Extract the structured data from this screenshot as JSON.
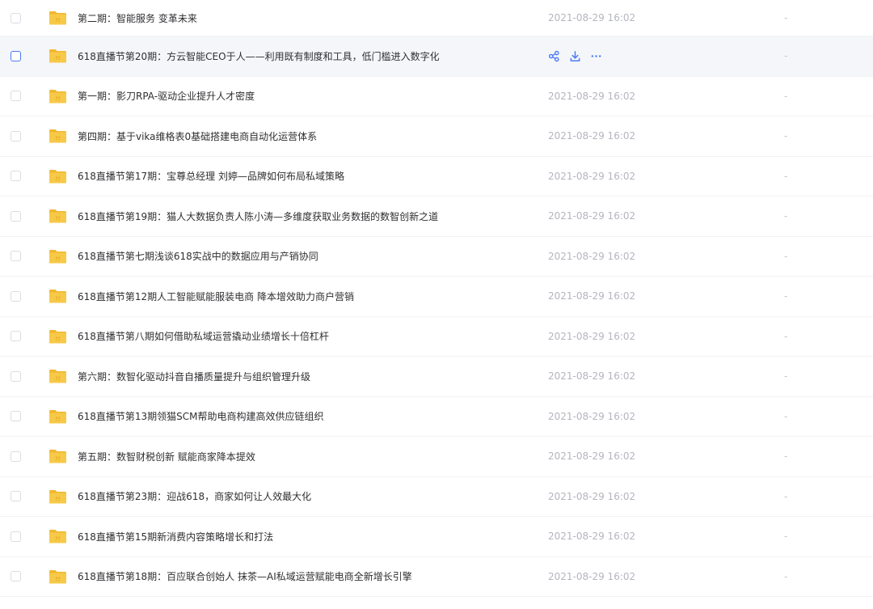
{
  "files": [
    {
      "name": "第二期：智能服务 变革未来",
      "modified": "2021-08-29 16:02",
      "size": "-"
    },
    {
      "name": "618直播节第20期：方云智能CEO于人——利用既有制度和工具，低门槛进入数字化",
      "modified": "2021-08-29 16:02",
      "size": "-",
      "hovered": true
    },
    {
      "name": "第一期：影刀RPA-驱动企业提升人才密度",
      "modified": "2021-08-29 16:02",
      "size": "-"
    },
    {
      "name": "第四期：基于vika维格表0基础搭建电商自动化运营体系",
      "modified": "2021-08-29 16:02",
      "size": "-"
    },
    {
      "name": "618直播节第17期：宝尊总经理 刘婷—品牌如何布局私域策略",
      "modified": "2021-08-29 16:02",
      "size": "-"
    },
    {
      "name": "618直播节第19期：猫人大数据负责人陈小涛—多维度获取业务数据的数智创新之道",
      "modified": "2021-08-29 16:02",
      "size": "-"
    },
    {
      "name": "618直播节第七期浅谈618实战中的数据应用与产销协同",
      "modified": "2021-08-29 16:02",
      "size": "-"
    },
    {
      "name": "618直播节第12期人工智能赋能服装电商 降本增效助力商户营销",
      "modified": "2021-08-29 16:02",
      "size": "-"
    },
    {
      "name": "618直播节第八期如何借助私域运营撬动业绩增长十倍杠杆",
      "modified": "2021-08-29 16:02",
      "size": "-"
    },
    {
      "name": "第六期：数智化驱动抖音自播质量提升与组织管理升级",
      "modified": "2021-08-29 16:02",
      "size": "-"
    },
    {
      "name": "618直播节第13期领猫SCM帮助电商构建高效供应链组织",
      "modified": "2021-08-29 16:02",
      "size": "-"
    },
    {
      "name": "第五期：数智财税创新 赋能商家降本提效",
      "modified": "2021-08-29 16:02",
      "size": "-"
    },
    {
      "name": "618直播节第23期：迎战618，商家如何让人效最大化",
      "modified": "2021-08-29 16:02",
      "size": "-"
    },
    {
      "name": "618直播节第15期新消费内容策略增长和打法",
      "modified": "2021-08-29 16:02",
      "size": "-"
    },
    {
      "name": "618直播节第18期：百应联合创始人 抹茶—AI私域运营赋能电商全新增长引擎",
      "modified": "2021-08-29 16:02",
      "size": "-"
    }
  ],
  "row_actions": [
    {
      "icon": "share-icon"
    },
    {
      "icon": "download-icon"
    },
    {
      "icon": "more-icon"
    }
  ],
  "colors": {
    "folder": "#f7c948",
    "accent": "#4a7cf4",
    "hover_bg": "#f5f6fa"
  }
}
